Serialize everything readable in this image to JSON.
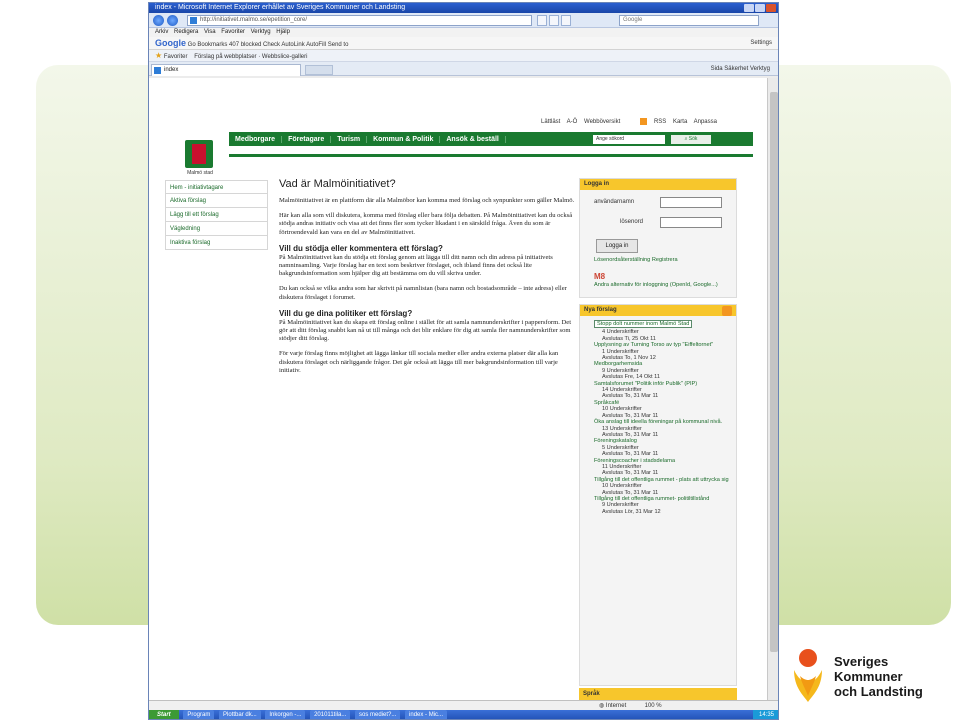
{
  "window": {
    "title": "index - Microsoft Internet Explorer erhållet av Sveriges Kommuner och Landsting",
    "address": "http://initiativet.malmo.se/epetition_core/",
    "search_placeholder": "Google",
    "menu": "Arkiv  Redigera  Visa  Favoriter  Verktyg  Hjälp",
    "googlebar": "Go  Bookmarks  407 blocked  Check  AutoLink  AutoFill  Send to",
    "googlebar_settings": "Settings",
    "favorites": "Favoriter",
    "favbar_items": "Förslag på webbplatser  ·  Webbslice-galleri",
    "tab_label": "index",
    "tools": "Sida  Säkerhet  Verktyg"
  },
  "site": {
    "utility_links": "Lättläst  A-Ö  Webböversikt",
    "utility_links2": "RSS  Karta  Anpassa",
    "logo_caption": "Malmö stad",
    "nav": [
      "Medborgare",
      "Företagare",
      "Turism",
      "Kommun & Politik",
      "Ansök & beställ"
    ],
    "search_value": "Ange sökord",
    "search_button": "Sök"
  },
  "leftnav": [
    "Hem - initiativtagare",
    "Aktiva förslag",
    "Lägg till ett förslag",
    "Vägledning",
    "Inaktiva förslag"
  ],
  "content": {
    "title": "Vad är Malmöinitiativet?",
    "p1": "Malmöinitiativet är en plattform där alla Malmöbor kan komma med förslag och synpunkter som gäller Malmö.",
    "p2": "Här kan alla som vill diskutera, komma med förslag eller bara följa debatten. På Malmöinitiativet kan du också stödja andras initiativ och visa att det finns fler som tycker likadant i en särskild fråga. Även du som är förtroendevald kan vara en del av Malmöinitiativet.",
    "h2a": "Vill du stödja eller kommentera ett förslag?",
    "p3": "På Malmöinitiativet kan du stödja ett förslag genom att lägga till ditt namn och din adress på initiativets namninsamling. Varje förslag har en text som beskriver förslaget, och ibland finns det också lite bakgrundsinformation som hjälper dig att bestämma om du vill skriva under.",
    "p4": "Du kan också se vilka andra som har skrivit på namnlistan (bara namn och bostadsområde – inte adress) eller diskutera förslaget i forumet.",
    "h2b": "Vill du ge dina politiker ett förslag?",
    "p5": "På Malmöinitiativet kan du skapa ett förslag online i stället för att samla namnunderskrifter i pappersform. Det gör att ditt förslag snabbt kan nå ut till många och det blir enklare för dig att samla fler namnunderskrifter som stödjer ditt förslag.",
    "p6": "För varje förslag finns möjlighet att lägga länkar till sociala medier eller andra externa platser där alla kan diskutera förslaget och närliggande frågor. Det går också att lägga till mer bakgrundsinformation till varje initiativ."
  },
  "login": {
    "header": "Logga in",
    "user_label": "användarnamn",
    "pass_label": "lösenord",
    "button": "Logga in",
    "links": "Lösenordsåterställning   Registrera",
    "openid_mark": "M8",
    "openid_text": "Andra alternativ för inloggning (OpenId, Google...)"
  },
  "nya": {
    "header": "Nya förslag",
    "items": [
      {
        "title": "Stopp dolt nummer inom Malmö Stad",
        "count": "4 Underskrifter",
        "end": "Avslutas Ti, 25 Okt 11"
      },
      {
        "title": "Upplysning av Turning Torso av typ \"Eiffeltornet\"",
        "count": "1 Underskrifter",
        "end": "Avslutas To, 1 Nov 12"
      },
      {
        "title": "Medborgarhemsida",
        "count": "9 Underskrifter",
        "end": "Avslutas Fre, 14 Okt 11"
      },
      {
        "title": "Samtalsforumet \"Politik inför Publik\" (PIP)",
        "count": "14 Underskrifter",
        "end": "Avslutas To, 31 Mar 11"
      },
      {
        "title": "Språkcafé",
        "count": "10 Underskrifter",
        "end": "Avslutas To, 31 Mar 11"
      },
      {
        "title": "Öka anslag till ideella föreningar på kommunal nivå.",
        "count": "13 Underskrifter",
        "end": "Avslutas To, 31 Mar 11"
      },
      {
        "title": "Föreningskatalog",
        "count": "5 Underskrifter",
        "end": "Avslutas To, 31 Mar 11"
      },
      {
        "title": "Föreningscoacher i stadsdelarna",
        "count": "11 Underskrifter",
        "end": "Avslutas To, 31 Mar 11"
      },
      {
        "title": "Tillgång till det offentliga rummet - plats att uttrycka sig",
        "count": "10 Underskrifter",
        "end": "Avslutas To, 31 Mar 11"
      },
      {
        "title": "Tillgång till det offentliga rummet- politiltillstånd",
        "count": "9 Underskrifter",
        "end": "Avslutas Lör, 31 Mar 12"
      }
    ]
  },
  "sprak": "Språk",
  "status": "Internet",
  "zoom": "100 %",
  "taskbar": {
    "start": "Start",
    "tasks": [
      "Program",
      "Plottbar dk...",
      "Inkorgen -...",
      "201011tila...",
      "sos mediet?...",
      "index - Mic..."
    ],
    "clock": "14:35"
  },
  "brand": {
    "line1": "Sveriges",
    "line2": "Kommuner",
    "line3": "och Landsting",
    "colors": {
      "accent": "#1a7a30",
      "yellow": "#f7c62c",
      "band": "#dfeac3"
    }
  }
}
